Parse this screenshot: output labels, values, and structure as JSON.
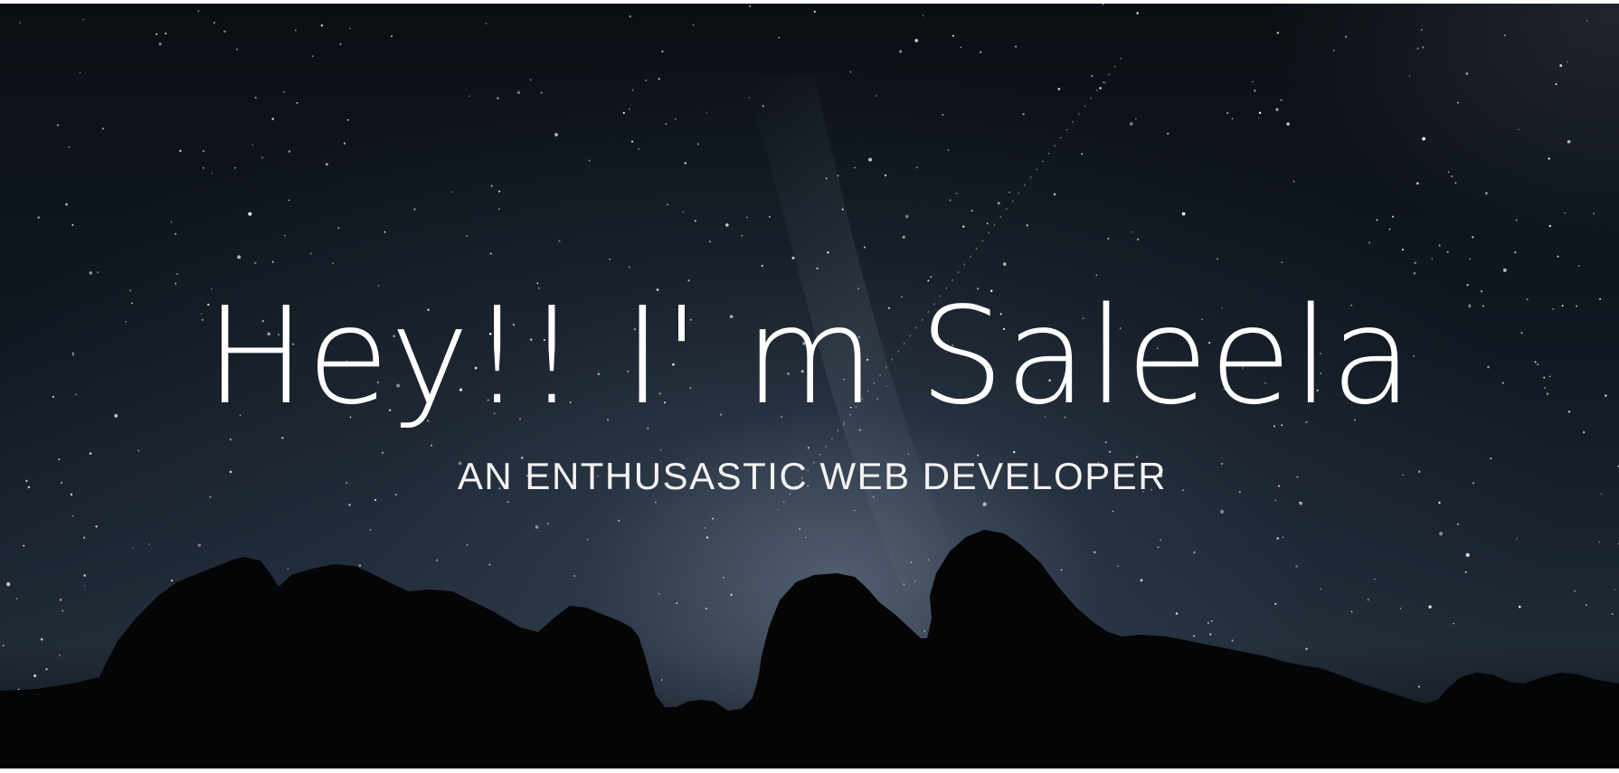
{
  "hero": {
    "headline": "Hey!! I' m Saleela",
    "subheadline": "AN ENTHUSASTIC WEB DEVELOPER",
    "background": "night-sky-mountains-image",
    "colors": {
      "text": "#ffffff",
      "sky_top": "#0b0f14",
      "sky_glow": "#8c9baf",
      "silhouette": "#040506"
    }
  }
}
